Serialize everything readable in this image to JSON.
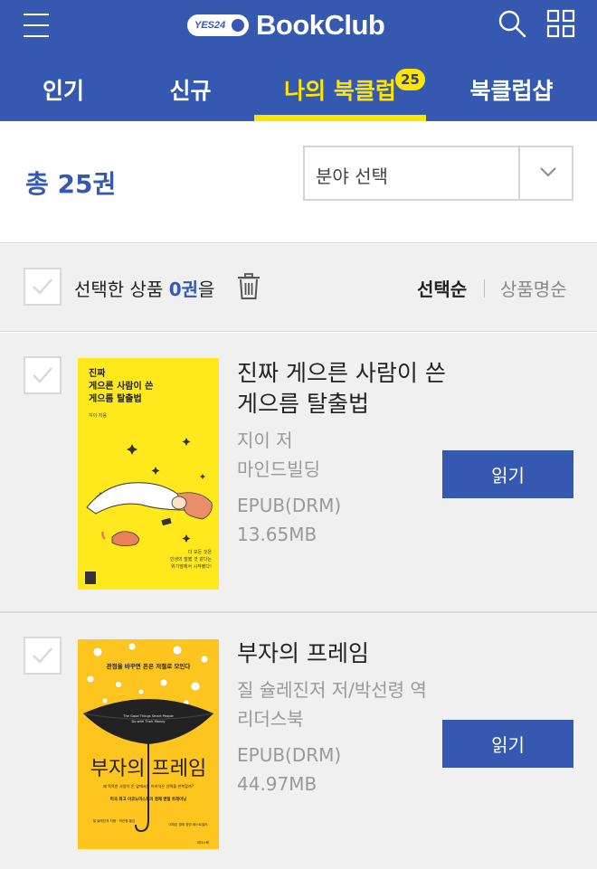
{
  "header": {
    "logo_prefix": "YES24",
    "logo_text": "BookClub"
  },
  "tabs": [
    {
      "label": "인기"
    },
    {
      "label": "신규"
    },
    {
      "label": "나의 북클럽",
      "badge": "25"
    },
    {
      "label": "북클럽샵"
    }
  ],
  "summary": {
    "count_label": "총 25권",
    "category_placeholder": "분야 선택"
  },
  "selection": {
    "label_prefix": "선택한 상품 ",
    "count": "0권",
    "label_suffix": "을",
    "sort_selected": "선택순",
    "sort_other": "상품명순"
  },
  "books": [
    {
      "title": "진짜 게으른 사람이 쓴 게으름 탈출법",
      "author": "지이 저",
      "publisher": "마인드빌딩",
      "format": "EPUB(DRM)",
      "size": "13.65MB",
      "button": "읽기",
      "cover": {
        "title_line1": "진짜",
        "title_line2": "게으른 사람이 쓴",
        "title_line3": "게으름 탈출법",
        "author": "지이 지음",
        "blurb_line1": "더 모든 것은",
        "blurb_line2": "인생의 말짧 것 같다는",
        "blurb_line3": "위기앞에서 시작됐다!"
      }
    },
    {
      "title": "부자의 프레임",
      "author": "질 슐레진저 저/박선령 역",
      "publisher": "리더스북",
      "format": "EPUB(DRM)",
      "size": "44.97MB",
      "button": "읽기",
      "cover": {
        "tagline": "관점을 바꾸면 돈은 저절로 모인다",
        "en_line1": "The Good Things Smart People",
        "en_line2": "Do with Their Money",
        "title": "부자의 프레임",
        "subtitle": "왜 똑똑한 사람이 돈 앞에서는 어리석은 선택을 반복할까?",
        "ribbon": "미국 최고 이코노미스트의 경제 멘탈 트레이닝",
        "authors": "질 슐레진저 지음 · 박선령 옮김",
        "bestseller": "아마존 경제 경영 베스트셀러",
        "publisher_mark": "리더스북"
      }
    }
  ],
  "colors": {
    "brand_blue": "#3559b0",
    "active_yellow": "#ffe600",
    "cover1_bg": "#ffe81c",
    "cover2_bg": "#ffc51f"
  }
}
